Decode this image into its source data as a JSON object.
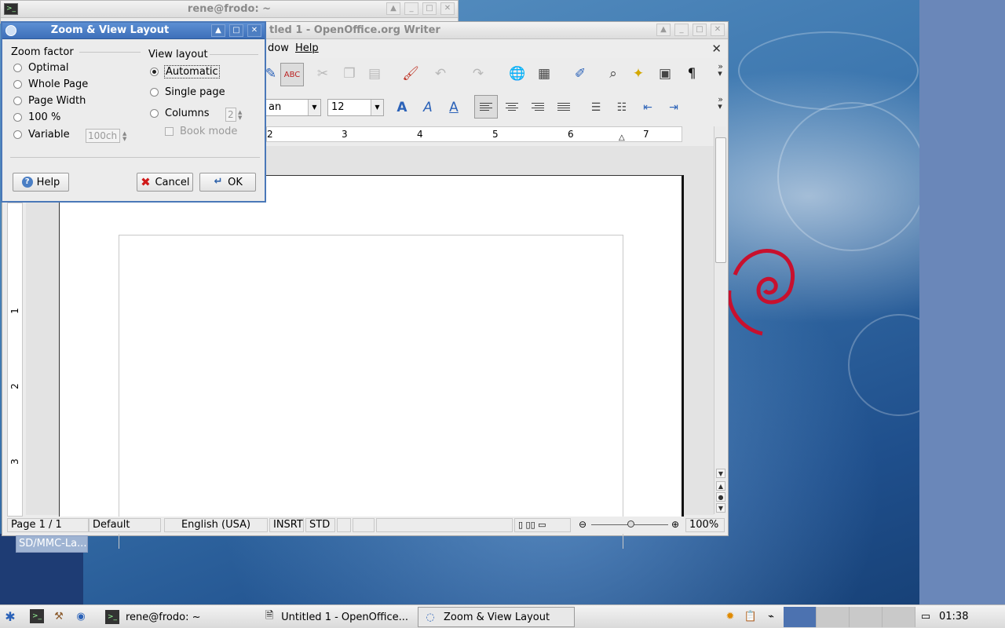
{
  "terminal_window": {
    "title": "rene@frodo: ~"
  },
  "writer": {
    "title": "Untitled 1 - OpenOffice.org Writer",
    "title_visible": "tled 1 - OpenOffice.org Writer",
    "menu": {
      "window_partial": "dow",
      "help": "Help"
    },
    "font_name_partial": "an",
    "font_size": "12",
    "ruler_numbers": [
      "2",
      "3",
      "4",
      "5",
      "6",
      "7"
    ],
    "vruler_numbers": [
      "1",
      "2",
      "3"
    ],
    "status": {
      "page": "Page 1 / 1",
      "style": "Default",
      "language": "English (USA)",
      "insert_mode": "INSRT",
      "selection_mode": "STD",
      "zoom": "100%"
    }
  },
  "desktop": {
    "sdmmc_label": "SD/MMC-La..."
  },
  "dialog": {
    "title": "Zoom & View Layout",
    "zoom_factor": {
      "title": "Zoom factor",
      "options": [
        "Optimal",
        "Whole Page",
        "Page Width",
        "100 %",
        "Variable"
      ],
      "variable_value": "100ch"
    },
    "view_layout": {
      "title": "View layout",
      "options": [
        "Automatic",
        "Single page",
        "Columns"
      ],
      "selected": "Automatic",
      "columns_value": "2",
      "book_mode": "Book mode"
    },
    "buttons": {
      "help": "Help",
      "cancel": "Cancel",
      "ok": "OK"
    }
  },
  "taskbar": {
    "tasks": [
      {
        "label": "rene@frodo: ~"
      },
      {
        "label": "Untitled 1 - OpenOffice..."
      },
      {
        "label": "Zoom & View Layout"
      }
    ],
    "clock": "01:38"
  }
}
